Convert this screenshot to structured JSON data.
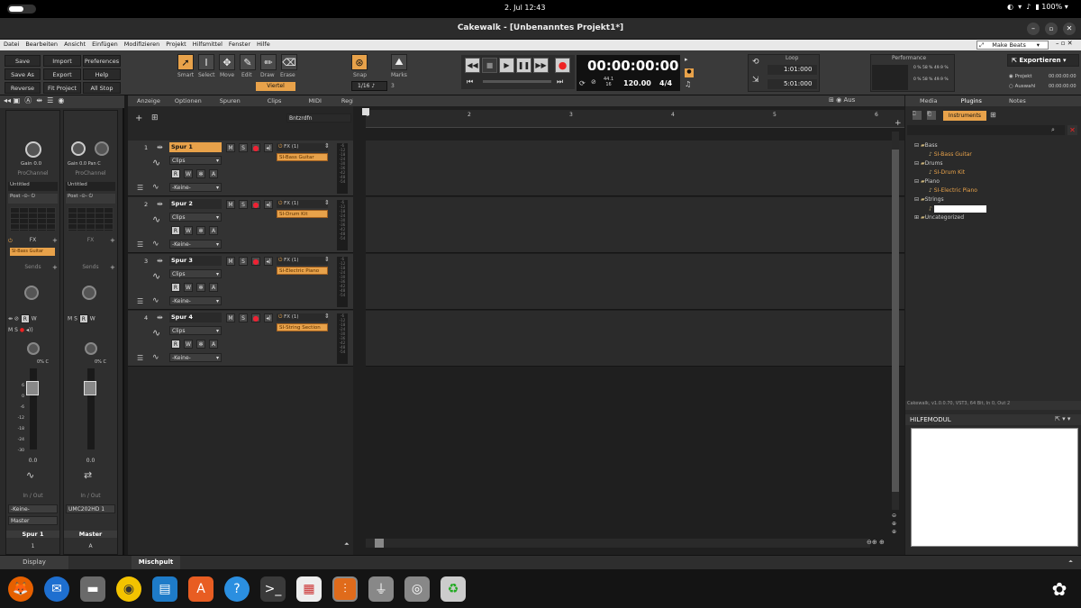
{
  "system": {
    "date": "2. Jul  12:43"
  },
  "window": {
    "title": "Cakewalk - [Unbenanntes Projekt1*]"
  },
  "menu": [
    "Datei",
    "Bearbeiten",
    "Ansicht",
    "Einfügen",
    "Modifizieren",
    "Projekt",
    "Hilfsmittel",
    "Fenster",
    "Hilfe"
  ],
  "workspace": {
    "label": "Make Beats"
  },
  "toolbar": {
    "project_buttons": [
      "Save",
      "Import",
      "Preferences",
      "Save As",
      "Export",
      "Help",
      "Reverse",
      "Fit Project",
      "All Stop"
    ],
    "tools": [
      "Smart",
      "Select",
      "Move",
      "Edit",
      "Draw",
      "Erase"
    ],
    "snap_value": "Viertel",
    "snap_label": "Snap",
    "snap_res": "1/16",
    "marks_label": "Marks",
    "marks_value": "3",
    "time": "00:00:00:00",
    "sample_rate": "44.1",
    "bit_depth": "16",
    "tempo": "120.00",
    "meter": "4/4",
    "loop_label": "Loop",
    "loop_start": "1:01:000",
    "loop_end": "5:01:000",
    "performance_label": "Performance",
    "perf_rows": [
      "0 %   58 %   49.9 %",
      "0 %   58 %   49.9 %"
    ],
    "export_label": "Exportieren",
    "export_project": "Projekt",
    "export_selection": "Auswahl",
    "export_time1": "00:00:00:00",
    "export_time2": "00:00:00:00"
  },
  "view_menu": [
    "Anzeige",
    "Optionen",
    "Spuren",
    "Clips",
    "MIDI",
    "Region-FX"
  ],
  "aus_label": "Aus",
  "ruler": [
    "1",
    "2",
    "3",
    "4",
    "5",
    "6"
  ],
  "track_filter": "Bntzrdfn",
  "tracks": [
    {
      "num": "1",
      "name": "Spur 1",
      "clips": "Clips",
      "fx": "FX (1)",
      "plugin": "SI-Bass Guitar",
      "input": "-Keine-"
    },
    {
      "num": "2",
      "name": "Spur 2",
      "clips": "Clips",
      "fx": "FX (1)",
      "plugin": "SI-Drum Kit",
      "input": "-Keine-"
    },
    {
      "num": "3",
      "name": "Spur 3",
      "clips": "Clips",
      "fx": "FX (1)",
      "plugin": "SI-Electric Piano",
      "input": "-Keine-"
    },
    {
      "num": "4",
      "name": "Spur 4",
      "clips": "Clips",
      "fx": "FX (1)",
      "plugin": "SI-String Section",
      "input": "-Keine-"
    }
  ],
  "meter_ticks": [
    "-6",
    "-12",
    "-18",
    "-24",
    "-30",
    "-36",
    "-42",
    "-48",
    "-54"
  ],
  "inspector": {
    "gain": "Gain",
    "gain_val": "0.0",
    "pan": "Pan",
    "pan_val": "C",
    "prochannel": "ProChannel",
    "preset1": "Untitled",
    "preset2": "Untitled",
    "post": "Post",
    "fx": "FX",
    "fx_plugin": "SI-Bass Guitar",
    "sends": "Sends",
    "pan_pct": "0% C",
    "fader_scale": [
      "6",
      "0",
      "-6",
      "-12",
      "-18",
      "-24",
      "-30"
    ],
    "vol1": "0.0",
    "vol2": "0.0",
    "inout": "In / Out",
    "in1": "-Keine-",
    "out1": "Master",
    "in2": "UMC202HD 1",
    "strip1": "Spur 1",
    "strip2": "Master",
    "strip1_num": "1",
    "strip2_num": "A",
    "display": "Display"
  },
  "browser": {
    "tabs": [
      "Media",
      "Plugins",
      "Notes"
    ],
    "instruments": "Instruments",
    "tree": [
      {
        "folder": "Bass",
        "items": [
          "SI-Bass Guitar"
        ]
      },
      {
        "folder": "Drums",
        "items": [
          "SI-Drum Kit"
        ]
      },
      {
        "folder": "Piano",
        "items": [
          "SI-Electric Piano"
        ]
      },
      {
        "folder": "Strings",
        "items": [
          ""
        ]
      },
      {
        "folder": "Uncategorized",
        "items": []
      }
    ],
    "status": "Cakewalk, v1.0.0.70, VST3, 64 Bit, In 0, Out 2"
  },
  "help": {
    "title": "HILFEMODUL"
  },
  "bottom_tabs": [
    "Mischpult"
  ],
  "dock": [
    "Firefox",
    "Thunderbird",
    "Files",
    "Rhythmbox",
    "Writer",
    "App Center",
    "Help",
    "Terminal",
    "Software",
    "Cakewalk",
    "USB",
    "Disks",
    "Trash"
  ],
  "colors": {
    "accent": "#e8a24a",
    "record": "#e22233"
  }
}
